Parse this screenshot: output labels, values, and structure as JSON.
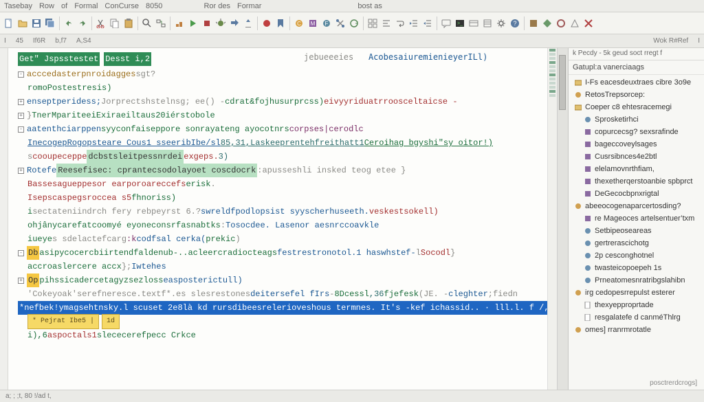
{
  "menu": {
    "items": [
      "Tasebay",
      "Row",
      "of",
      "Formal",
      "ConCurse",
      "8050",
      "Ror des",
      "Formar",
      "bost as"
    ]
  },
  "toolbar": {
    "icons": [
      "file",
      "folder",
      "save",
      "saveall",
      "undo",
      "redo",
      "cut",
      "copy",
      "paste",
      "find",
      "replace",
      "build",
      "run",
      "stop",
      "debug",
      "step",
      "stepout",
      "breakpoint",
      "bookmark",
      "class",
      "method",
      "field",
      "refactor",
      "sync",
      "grid",
      "format",
      "wrap",
      "indent",
      "dedent",
      "comment",
      "uncomment",
      "terminal",
      "output",
      "props",
      "settings",
      "help",
      "ext1",
      "ext2",
      "ext3",
      "ext4",
      "ext5"
    ]
  },
  "secondary": {
    "items": [
      "I",
      "45",
      "If6R",
      "b,f7",
      "A,S4",
      "",
      "Wok R#Ref",
      "I"
    ]
  },
  "split_right": {
    "top_a": "jebueeeies",
    "top_b": "AcobesaiuremienieyerILl)"
  },
  "editor_tab_a": "Get\" Jspsstestet",
  "editor_tab_b": "Desst i,2",
  "lines": [
    {
      "fold": "-",
      "tokens": [
        [
          "attr",
          "acccedasterpnroidagges"
        ],
        [
          "comm",
          " sgt?"
        ]
      ]
    },
    {
      "fold": " ",
      "tokens": [
        [
          "kw",
          "romoPostestresis)"
        ]
      ]
    },
    {
      "fold": "+",
      "tokens": [
        [
          "type",
          "enseptperidess;"
        ],
        [
          "comm",
          " Jorprectshstelnsg; ee()  - "
        ],
        [
          "kw",
          "cdrat&fojhusurprcss)"
        ],
        [
          "str",
          "eivyyriduatrroosceltaicse -"
        ]
      ]
    },
    {
      "fold": "+",
      "tokens": [
        [
          "comm",
          "}"
        ],
        [
          "kw",
          "TnerMpariteeiExiraeiltaus20iérstobole"
        ]
      ]
    },
    {
      "fold": "-",
      "tokens": [
        [
          "type",
          "aatenthciarppen "
        ],
        [
          "kw",
          "syyconfaiseppore sonrayateng ayocotnrs "
        ],
        [
          "fn",
          "corpses|cerodlc"
        ]
      ]
    },
    {
      "fold": " ",
      "tokens": [
        [
          "type",
          "InecogepRogopsteare Cous1 sseeribIbe/sl"
        ],
        [
          "num",
          "85,31,Laskeeprentehfreithatt1"
        ],
        [
          "kw",
          " Ceroihag bgyshi\"sy oitor!)"
        ]
      ],
      "underline": true
    },
    {
      "fold": " ",
      "tokens": [
        [
          "comm",
          "s "
        ],
        [
          "str",
          "cooupeceppe"
        ],
        [
          "hl",
          "dcbstsleitpessnrdei",
          "lgrn"
        ],
        [
          "str",
          " exgeps."
        ],
        [
          "num",
          "3)"
        ]
      ]
    },
    {
      "fold": "+",
      "tokens": [
        [
          "type",
          "Rotefe"
        ],
        [
          "hl",
          "Reesefisec: cprantecsodolayoet coscdocrk",
          "lgrn"
        ],
        [
          "comm",
          "     :apusseshli insked teog etee  }"
        ]
      ]
    },
    {
      "fold": " ",
      "tokens": [
        [
          "str",
          "Bassesagueppesor  earporoareccefs "
        ],
        [
          "kw",
          "erisk"
        ],
        [
          "comm",
          "."
        ]
      ]
    },
    {
      "fold": " ",
      "tokens": [
        [
          "str",
          "Isepscaspegsroccea s5 "
        ],
        [
          "kw",
          "fhnoriss)"
        ]
      ]
    },
    {
      "fold": " ",
      "tokens": [
        [
          "kw",
          "i"
        ],
        [
          "comm",
          "sectateniindrch fery    rebpeyrst 6.?  "
        ],
        [
          "type",
          "swreldfpodlopsist syyscherhuseeth."
        ],
        [
          "str",
          " veskestsokell)"
        ]
      ]
    },
    {
      "fold": " ",
      "tokens": [
        [
          "kw",
          "ohjânycarefatcoomyé eyoneconsrfasnabtks"
        ],
        [
          "comm",
          " : "
        ],
        [
          "type",
          "Tosocdee. Lasenor  aesnrccoavkle"
        ]
      ]
    },
    {
      "fold": " ",
      "tokens": [
        [
          "kw",
          "iueye"
        ],
        [
          "comm",
          "s sdelactefcarg "
        ],
        [
          "fn",
          ":k"
        ],
        [
          "comm",
          "  "
        ],
        [
          "type",
          "codfsal cerka("
        ],
        [
          "kw",
          "prekic"
        ],
        [
          "comm",
          ")"
        ]
      ]
    },
    {
      "fold": "-",
      "tokens": [
        [
          "hl",
          "Db",
          "yel"
        ],
        [
          "kw",
          "asipycocercbiirten"
        ],
        [
          "str",
          "",
          ""
        ],
        [
          "kw",
          "dfaldenub-..acleercradiocteags"
        ],
        [
          "comm",
          "   "
        ],
        [
          "type",
          "festrestronotol.1 haswhstef-"
        ],
        [
          "comm",
          "l  "
        ],
        [
          "str",
          "Socodl "
        ],
        [
          "comm",
          "}"
        ]
      ]
    },
    {
      "fold": " ",
      "tokens": [
        [
          "kw",
          "accroaslercere accx"
        ],
        [
          "comm",
          "};  "
        ],
        [
          "type",
          "Iwtehes"
        ]
      ]
    },
    {
      "fold": "+",
      "tokens": [
        [
          "hl",
          "Op",
          "yel"
        ],
        [
          "kw",
          "pihssicadercetagyzsezloss"
        ],
        [
          "comm",
          "    "
        ],
        [
          "type",
          "easposterictull)"
        ]
      ]
    },
    {
      "fold": " ",
      "tokens": [
        [
          "comm",
          " 'Cokeyoak'serefneresce.textf*.es slesrestones"
        ],
        [
          "type",
          " deitersefel fIrs"
        ],
        [
          "comm",
          " - "
        ],
        [
          "kw",
          "8Dcessl"
        ],
        [
          "num",
          ",36"
        ],
        [
          "kw",
          "fjefesk"
        ],
        [
          "comm",
          "(JE. - "
        ],
        [
          "type",
          "cleghter"
        ],
        [
          "comm",
          ";fiedn"
        ]
      ]
    },
    {
      "fold": " ",
      "tokens": [
        [
          "sel",
          "          *nefbek!ymagsehtnsky.l  scuset   2e8là kd rursdibeesrelerioveshous termnes.  It's -kef ichassid..    ·  lll.l.      f /,.",
          "blue"
        ]
      ]
    },
    {
      "fold": " ",
      "tokens": [
        [
          "btab",
          "* Pejrat Ibe5 |"
        ],
        [
          "btab",
          " 1d "
        ]
      ]
    },
    {
      "fold": " ",
      "tokens": [
        [
          "kw",
          "i),6"
        ],
        [
          "str",
          "aspoctals1"
        ],
        [
          "kw",
          "slececerefpecc Crkce"
        ]
      ]
    }
  ],
  "rpanel": {
    "header": "k Pecdy - 5k geud soct rregt f",
    "title": "Gatupl:a vanerciaags",
    "root": "I-Fs eacesdeuxtraes cibre 3o9e",
    "nodes": [
      {
        "lvl": 1,
        "icon": "class",
        "text": "RetosTrepsorcep:"
      },
      {
        "lvl": 1,
        "icon": "folder",
        "text": "Coeper c8 ehtesracemegi"
      },
      {
        "lvl": 2,
        "icon": "field",
        "text": "Sprosketirhci"
      },
      {
        "lvl": 2,
        "icon": "method",
        "text": "copurcecsg? sexsrafinde"
      },
      {
        "lvl": 2,
        "icon": "method",
        "text": "bageccoveylsages"
      },
      {
        "lvl": 2,
        "icon": "method",
        "text": "Cusrsibnces4e2btl"
      },
      {
        "lvl": 2,
        "icon": "method",
        "text": "elelamovnrthfiam,"
      },
      {
        "lvl": 2,
        "icon": "method",
        "text": "thexetherqerstoanbie spbprct"
      },
      {
        "lvl": 2,
        "icon": "method",
        "text": "DeGecocbpnxrigtal"
      },
      {
        "lvl": 1,
        "icon": "class",
        "text": "abeeocogenaparcertosding?"
      },
      {
        "lvl": 2,
        "icon": "method",
        "text": "re Mageoces artelsentuer’txm"
      },
      {
        "lvl": 2,
        "icon": "field",
        "text": "Setbipeoseareas"
      },
      {
        "lvl": 2,
        "icon": "field",
        "text": "gertrerascichotg"
      },
      {
        "lvl": 2,
        "icon": "field",
        "text": "2p cesconghotnel"
      },
      {
        "lvl": 2,
        "icon": "field",
        "text": "twasteicopoepeh 1s"
      },
      {
        "lvl": 2,
        "icon": "field",
        "text": "Prneatomesnratribgslahibn"
      },
      {
        "lvl": 1,
        "icon": "class",
        "text": "irg cedopesrrepulst esterer"
      },
      {
        "lvl": 2,
        "icon": "file",
        "text": "thexyepproprtade"
      },
      {
        "lvl": 2,
        "icon": "file",
        "text": "resgalatefe d canméThlrg"
      },
      {
        "lvl": 1,
        "icon": "class",
        "text": "omes] rranrmrotatle"
      }
    ],
    "footer": "posctrerdcrogs]"
  },
  "statusbar": {
    "text": "a;  ; ;t,    80 !/ad t,"
  }
}
